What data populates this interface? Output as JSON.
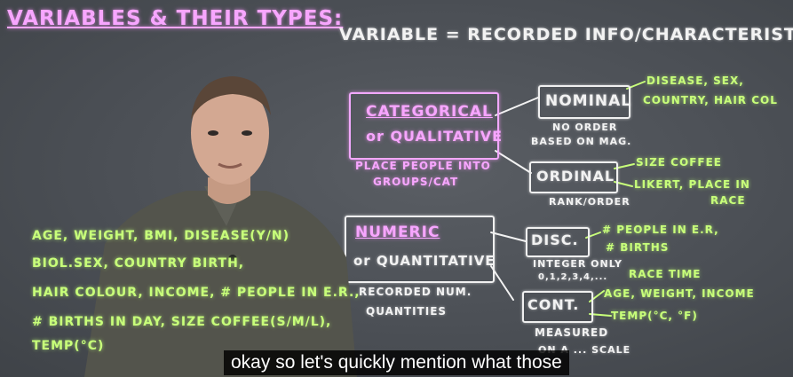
{
  "title": "VARIABLES & THEIR TYPES:",
  "definition": "VARIABLE = RECORDED INFO/CHARACTERISTIC",
  "categorical": {
    "label_line1": "CATEGORICAL",
    "label_line2": "or QUALITATIVE",
    "note_line1": "PLACE PEOPLE INTO",
    "note_line2": "GROUPS/CAT",
    "nominal": "NOMINAL",
    "nominal_note_line1": "NO ORDER",
    "nominal_note_line2": "BASED ON MAG.",
    "nominal_examples_line1": "DISEASE, SEX,",
    "nominal_examples_line2": "COUNTRY, HAIR COL",
    "ordinal": "ORDINAL",
    "ordinal_note": "RANK/ORDER",
    "ordinal_examples_line1": "SIZE COFFEE",
    "ordinal_examples_line2": "LIKERT, PLACE IN",
    "ordinal_examples_line3": "RACE"
  },
  "numeric": {
    "label_line1": "NUMERIC",
    "label_line2": "or QUANTITATIVE",
    "note_line1": "RECORDED NUM.",
    "note_line2": "QUANTITIES",
    "discrete": "DISC.",
    "discrete_note_line1": "INTEGER ONLY",
    "discrete_note_line2": "0,1,2,3,4,...",
    "discrete_examples_line1": "# PEOPLE IN E.R,",
    "discrete_examples_line2": "# BIRTHS",
    "continuous": "CONT.",
    "continuous_note_line1": "MEASURED",
    "continuous_note_line2": "ON A ... SCALE",
    "continuous_examples_line1": "RACE TIME",
    "continuous_examples_line2": "AGE, WEIGHT, INCOME",
    "continuous_examples_line3": "TEMP(°C, °F)"
  },
  "examples_list": [
    "AGE, WEIGHT, BMI, DISEASE(Y/N)",
    "BIOL.SEX, COUNTRY BIRTH,",
    "HAIR COLOUR, INCOME, # PEOPLE IN E.R.,",
    "# BIRTHS IN DAY, SIZE COFFEE(S/M/L),",
    "TEMP(°C)"
  ],
  "caption": "okay so let's quickly mention what those"
}
